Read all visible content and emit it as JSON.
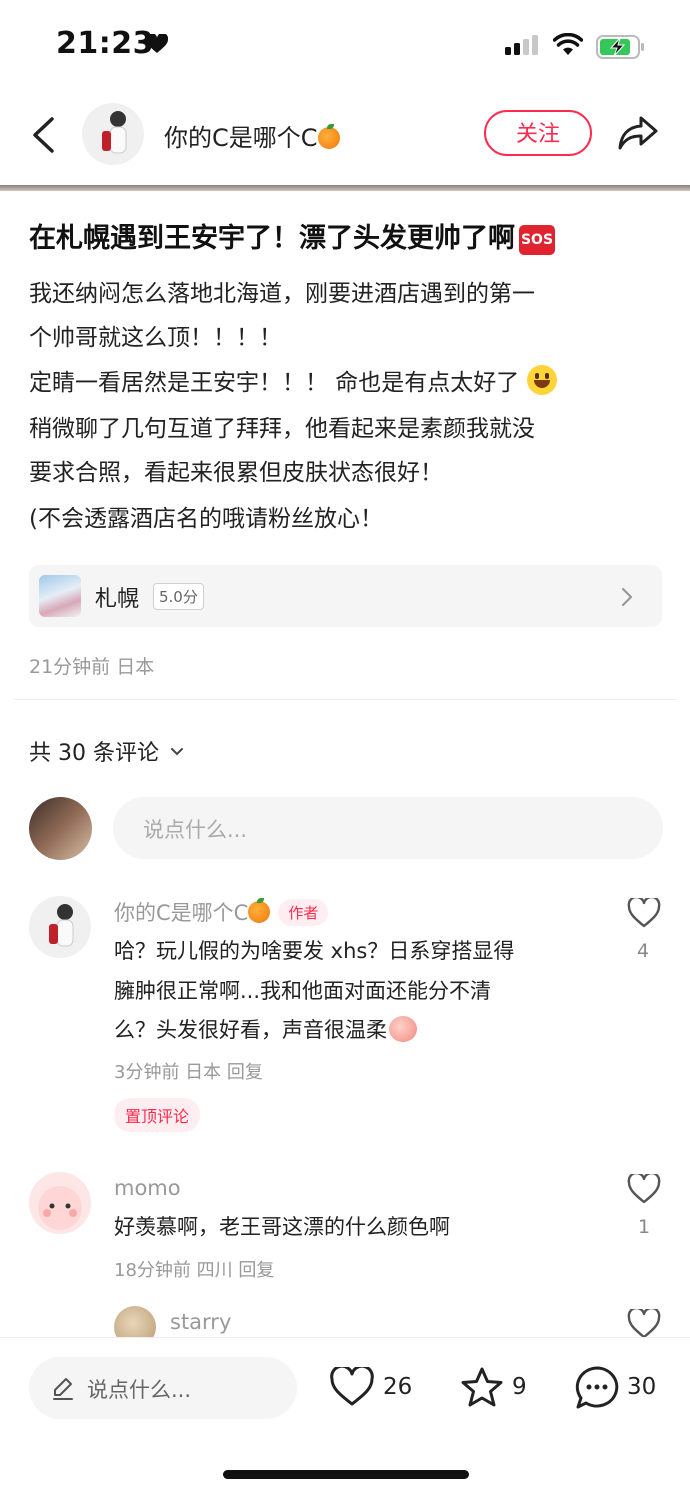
{
  "status_bar": {
    "time": "21:23"
  },
  "header": {
    "author": "你的C是哪个C",
    "follow_label": "关注"
  },
  "post": {
    "title": "在札幌遇到王安宇了！漂了头发更帅了啊",
    "title_badge": "SOS",
    "body_lines": [
      "我还纳闷怎么落地北海道，刚要进酒店遇到的第一",
      "个帅哥就这么顶！！！！",
      "定睛一看居然是王安宇！！！ 命也是有点太好了",
      "稍微聊了几句互道了拜拜，他看起来是素颜我就没",
      "要求合照，看起来很累但皮肤状态很好！",
      "(不会透露酒店名的哦请粉丝放心！"
    ],
    "location": {
      "name": "札幌",
      "score": "5.0分"
    },
    "meta": "21分钟前 日本"
  },
  "comments_section": {
    "count_label": "共 30 条评论",
    "input_placeholder": "说点什么...",
    "comments": [
      {
        "name": "你的C是哪个C",
        "tag": "作者",
        "text_lines": [
          "哈？玩儿假的为啥要发 xhs？日系穿搭显得",
          "臃肿很正常啊...我和他面对面还能分不清",
          "么？头发很好看，声音很温柔"
        ],
        "meta": "3分钟前 日本 回复",
        "pin_label": "置顶评论",
        "likes": "4"
      },
      {
        "name": "momo",
        "text_lines": [
          "好羡慕啊，老王哥这漂的什么颜色啊"
        ],
        "meta": "18分钟前 四川 回复",
        "likes": "1"
      },
      {
        "name": "starry"
      }
    ]
  },
  "bottom_bar": {
    "input_placeholder": "说点什么...",
    "likes": "26",
    "favorites": "9",
    "comments": "30"
  },
  "colors": {
    "accent": "#ff2a4d",
    "muted": "#999999",
    "input_bg": "#f5f5f5"
  }
}
